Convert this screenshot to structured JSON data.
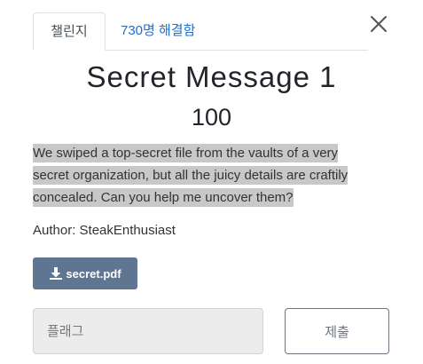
{
  "tabs": {
    "challenge_label": "챌린지",
    "solves_label": "730명 해결함"
  },
  "challenge": {
    "title": "Secret Message 1",
    "points": "100",
    "description_lines": [
      "We swiped a top-secret file from the vaults of a very",
      "secret organization, but all the juicy details are craftily",
      "concealed. Can you help me uncover them?"
    ],
    "author": "Author: SteakEnthusiast",
    "file_name": "secret.pdf"
  },
  "form": {
    "flag_placeholder": "플래그",
    "submit_label": "제출"
  },
  "icons": {
    "close": "close-icon",
    "download": "download-icon"
  },
  "colors": {
    "accent_link": "#1f6fd1",
    "file_button": "#5e7691",
    "highlight": "#c8c8c8"
  }
}
